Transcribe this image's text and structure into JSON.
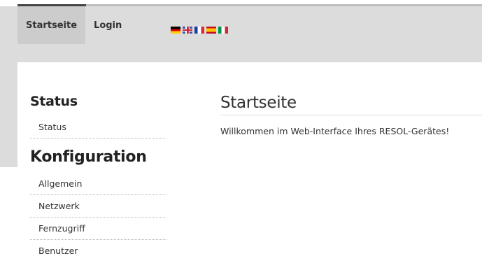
{
  "nav": {
    "items": [
      {
        "label": "Startseite",
        "active": true
      },
      {
        "label": "Login",
        "active": false
      }
    ],
    "flags": [
      "flag-de-icon",
      "flag-gb-icon",
      "flag-fr-icon",
      "flag-es-icon",
      "flag-it-icon"
    ]
  },
  "sidebar": {
    "status_heading": "Status",
    "status_items": [
      {
        "label": "Status"
      }
    ],
    "config_heading": "Konfiguration",
    "config_items": [
      {
        "label": "Allgemein"
      },
      {
        "label": "Netzwerk"
      },
      {
        "label": "Fernzugriff"
      },
      {
        "label": "Benutzer"
      }
    ]
  },
  "main": {
    "title": "Startseite",
    "welcome": "Willkommen im Web-Interface Ihres RESOL-Gerätes!"
  },
  "colors": {
    "header_bg": "#dcdcdc",
    "active_tab_bg": "#cccccc",
    "text": "#333333"
  }
}
